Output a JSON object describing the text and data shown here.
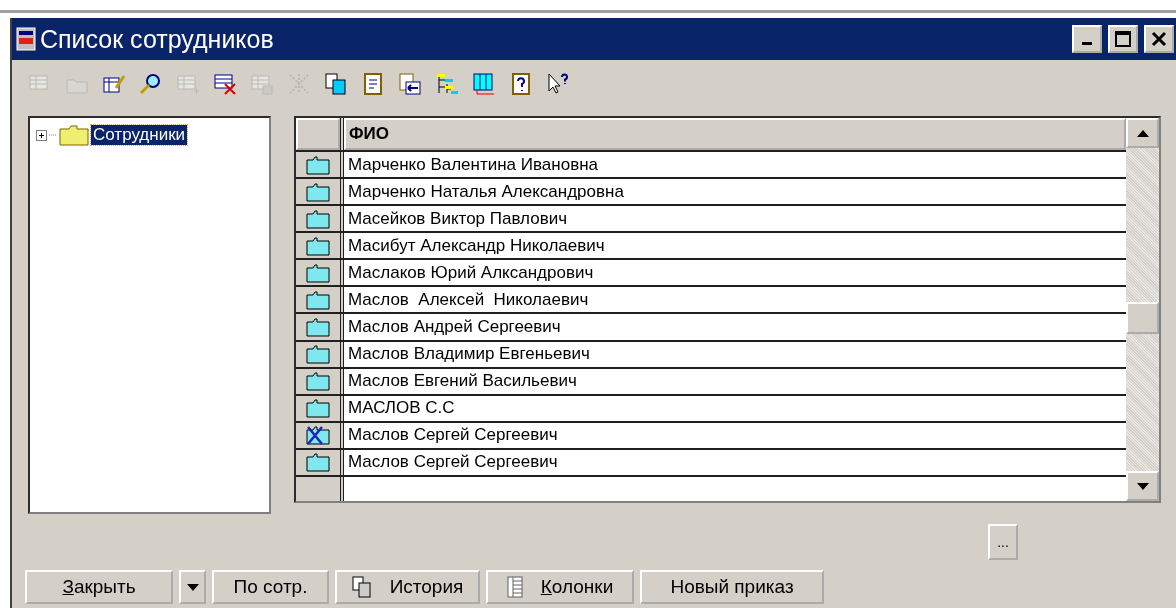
{
  "window": {
    "title": "Список сотрудников",
    "controls": [
      {
        "kind": "minimize"
      },
      {
        "kind": "maximize"
      },
      {
        "kind": "close"
      }
    ]
  },
  "toolbar": [
    {
      "kind": "grid",
      "disabled": true
    },
    {
      "kind": "folder",
      "disabled": true
    },
    {
      "kind": "edit",
      "disabled": false
    },
    {
      "kind": "find",
      "disabled": false
    },
    {
      "kind": "add-row",
      "disabled": true
    },
    {
      "kind": "delete-row",
      "disabled": false
    },
    {
      "kind": "copy-row",
      "disabled": true
    },
    {
      "kind": "tools",
      "disabled": true
    },
    {
      "kind": "copy",
      "disabled": false
    },
    {
      "kind": "document",
      "disabled": false
    },
    {
      "kind": "move",
      "disabled": false
    },
    {
      "kind": "tree",
      "disabled": false
    },
    {
      "kind": "columns",
      "disabled": false
    },
    {
      "kind": "help",
      "disabled": false
    },
    {
      "kind": "pointer-help",
      "disabled": false
    }
  ],
  "tree": {
    "items": [
      {
        "label": "Сотрудники",
        "selected": true,
        "expanded": false
      }
    ]
  },
  "table": {
    "columns": [
      "ФИО"
    ],
    "rows": [
      {
        "kind": "folder",
        "name": "Марченко Валентина Ивановна"
      },
      {
        "kind": "folder",
        "name": "Марченко Наталья Александровна"
      },
      {
        "kind": "folder",
        "name": "Масейков Виктор Павлович"
      },
      {
        "kind": "folder",
        "name": "Масибут Александр Николаевич"
      },
      {
        "kind": "folder",
        "name": "Маслаков Юрий Алксандрович"
      },
      {
        "kind": "folder",
        "name": "Маслов  Алексей  Николаевич"
      },
      {
        "kind": "folder",
        "name": "Маслов Андрей Сергеевич"
      },
      {
        "kind": "folder",
        "name": "Маслов Владимир Евгеньевич"
      },
      {
        "kind": "folder",
        "name": "Маслов Евгений Васильевич"
      },
      {
        "kind": "folder",
        "name": "МАСЛОВ С.С"
      },
      {
        "kind": "deleted",
        "name": "Маслов Сергей Сергеевич"
      },
      {
        "kind": "folder",
        "name": "Маслов Сергей Сергеевич"
      }
    ]
  },
  "ellipsis_button": "...",
  "buttons": [
    {
      "kind": "text",
      "label": "Закрыть",
      "underline_first": true
    },
    {
      "kind": "dropdown"
    },
    {
      "kind": "text",
      "label": "По сотр.",
      "underline_first": false
    },
    {
      "kind": "copy",
      "label": "История",
      "underline_first": false
    },
    {
      "kind": "columns",
      "label": "Колонки",
      "underline_first": true
    },
    {
      "kind": "text",
      "label": "Новый приказ",
      "underline_first": false
    }
  ]
}
